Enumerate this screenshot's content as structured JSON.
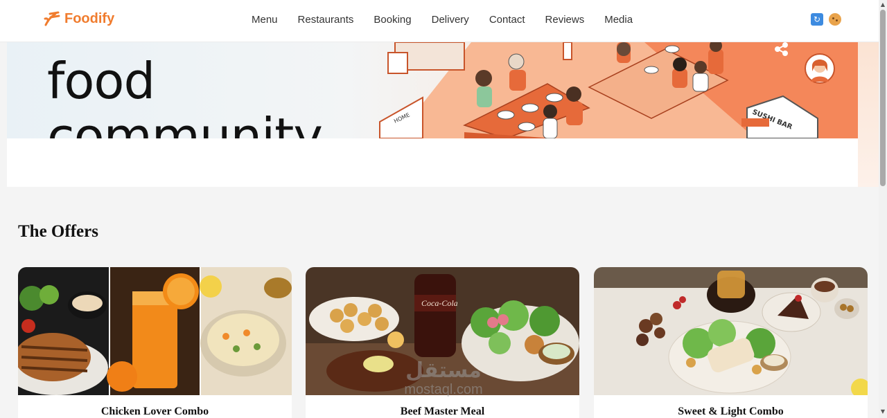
{
  "brand": {
    "name": "Foodify",
    "color": "#f07c2e"
  },
  "nav": {
    "items": [
      {
        "label": "Menu"
      },
      {
        "label": "Restaurants"
      },
      {
        "label": "Booking"
      },
      {
        "label": "Delivery"
      },
      {
        "label": "Contact"
      },
      {
        "label": "Reviews"
      },
      {
        "label": "Media"
      }
    ]
  },
  "header_icons": [
    "refresh-icon",
    "cookie-icon"
  ],
  "hero": {
    "line1": "food",
    "line2": "community",
    "sign_home": "HOME",
    "sign_sushi": "SUSHI BAR",
    "accent": "#f4875a"
  },
  "offers": {
    "title": "The Offers",
    "cards": [
      {
        "title": "Chicken Lover Combo"
      },
      {
        "title": "Beef Master Meal",
        "drink_label": "Coca-Cola"
      },
      {
        "title": "Sweet & Light Combo"
      }
    ]
  },
  "watermark": {
    "arabic": "مستقل",
    "latin": "mostaql.com"
  }
}
